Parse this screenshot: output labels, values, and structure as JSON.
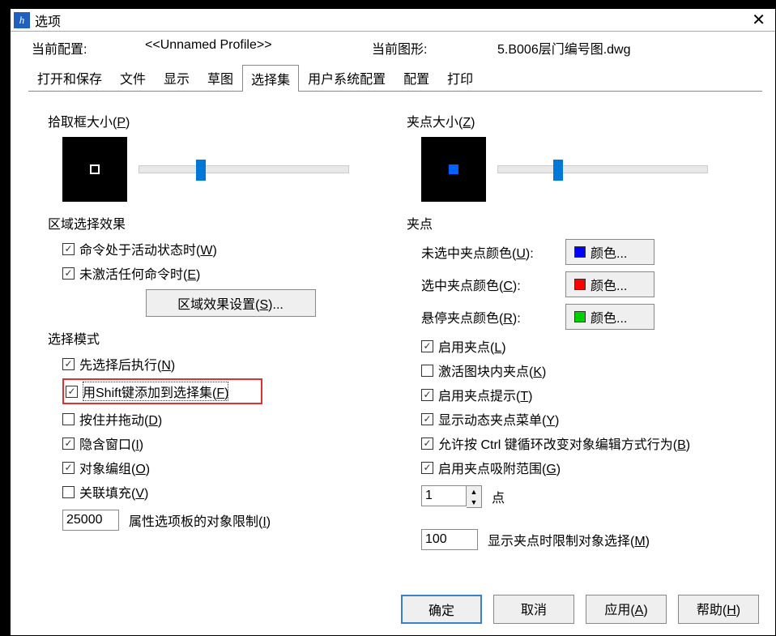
{
  "title": "选项",
  "profile_label": "当前配置:",
  "profile_value": "<<Unnamed Profile>>",
  "drawing_label": "当前图形:",
  "drawing_value": "5.B006层门编号图.dwg",
  "tabs": [
    "打开和保存",
    "文件",
    "显示",
    "草图",
    "选择集",
    "用户系统配置",
    "配置",
    "打印"
  ],
  "left": {
    "pickbox_title": "拾取框大小(P)",
    "area_title": "区域选择效果",
    "area_chk1": "命令处于活动状态时(W)",
    "area_chk2": "未激活任何命令时(E)",
    "area_btn": "区域效果设置(S)...",
    "mode_title": "选择模式",
    "mode_chk1": "先选择后执行(N)",
    "mode_chk2": "用Shift键添加到选择集(F)",
    "mode_chk3": "按住并拖动(D)",
    "mode_chk4": "隐含窗口(I)",
    "mode_chk5": "对象编组(O)",
    "mode_chk6": "关联填充(V)",
    "limit_value": "25000",
    "limit_label": "属性选项板的对象限制(I)"
  },
  "right": {
    "gripsize_title": "夹点大小(Z)",
    "grip_title": "夹点",
    "color_un_label": "未选中夹点颜色(U):",
    "color_sel_label": "选中夹点颜色(C):",
    "color_hov_label": "悬停夹点颜色(R):",
    "color_btn_text": "颜色...",
    "color_un": "#0000ff",
    "color_sel": "#ff0000",
    "color_hov": "#00d000",
    "g1": "启用夹点(L)",
    "g2": "激活图块内夹点(K)",
    "g3": "启用夹点提示(T)",
    "g4": "显示动态夹点菜单(Y)",
    "g5": "允许按 Ctrl 键循环改变对象编辑方式行为(B)",
    "g6": "启用夹点吸附范围(G)",
    "num1_value": "1",
    "num1_label": "点",
    "num2_value": "100",
    "num2_label": "显示夹点时限制对象选择(M)"
  },
  "footer": {
    "ok": "确定",
    "cancel": "取消",
    "apply": "应用(A)",
    "help": "帮助(H)"
  }
}
